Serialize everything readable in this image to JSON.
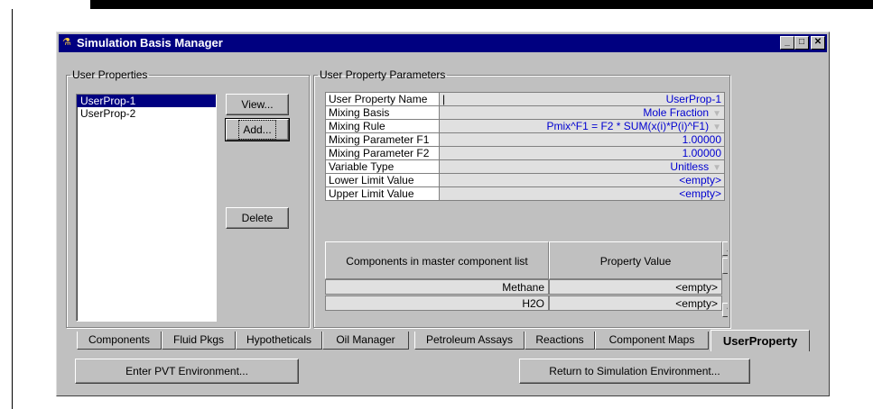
{
  "window": {
    "title": "Simulation Basis Manager",
    "controls": [
      "minimize",
      "maximize",
      "close"
    ]
  },
  "user_properties": {
    "group_label": "User Properties",
    "items": [
      "UserProp-1",
      "UserProp-2"
    ],
    "selected": "UserProp-1",
    "buttons": {
      "view": "View...",
      "add": "Add...",
      "delete": "Delete"
    }
  },
  "parameters": {
    "group_label": "User Property Parameters",
    "rows": [
      {
        "name": "User Property Name",
        "value": "UserProp-1",
        "dropdown": false
      },
      {
        "name": "Mixing Basis",
        "value": "Mole Fraction",
        "dropdown": true
      },
      {
        "name": "Mixing Rule",
        "value": "Pmix^F1 = F2 * SUM(x(i)*P(i)^F1)",
        "dropdown": true
      },
      {
        "name": "Mixing Parameter F1",
        "value": "1.00000",
        "dropdown": false
      },
      {
        "name": "Mixing Parameter F2",
        "value": "1.00000",
        "dropdown": false
      },
      {
        "name": "Variable Type",
        "value": "Unitless",
        "dropdown": true
      },
      {
        "name": "Lower Limit Value",
        "value": "<empty>",
        "dropdown": false
      },
      {
        "name": "Upper Limit Value",
        "value": "<empty>",
        "dropdown": false
      }
    ]
  },
  "components_table": {
    "headers": [
      "Components in master component list",
      "Property Value"
    ],
    "rows": [
      {
        "component": "Methane",
        "value": "<empty>"
      },
      {
        "component": "H2O",
        "value": "<empty>"
      }
    ]
  },
  "tabs": [
    "Components",
    "Fluid Pkgs",
    "Hypotheticals",
    "Oil Manager",
    "Petroleum Assays",
    "Reactions",
    "Component Maps",
    "UserProperty"
  ],
  "active_tab": "UserProperty",
  "footer": {
    "enter_pvt": "Enter PVT Environment...",
    "return_sim": "Return to Simulation Environment..."
  },
  "colors": {
    "title_bar": "#000080",
    "value_text": "#0000d0",
    "selection": "#000080"
  }
}
